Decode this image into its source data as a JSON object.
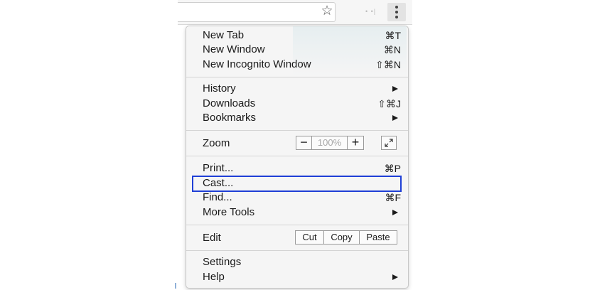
{
  "toolbar": {
    "bookmark_icon": "star-icon",
    "menu_icon": "kebab-icon"
  },
  "menu": {
    "new_tab": {
      "label": "New Tab",
      "shortcut": "⌘T"
    },
    "new_window": {
      "label": "New Window",
      "shortcut": "⌘N"
    },
    "new_incognito": {
      "label": "New Incognito Window",
      "shortcut": "⇧⌘N"
    },
    "history": {
      "label": "History"
    },
    "downloads": {
      "label": "Downloads",
      "shortcut": "⇧⌘J"
    },
    "bookmarks": {
      "label": "Bookmarks"
    },
    "zoom": {
      "label": "Zoom",
      "minus": "−",
      "value": "100%",
      "plus": "+"
    },
    "print": {
      "label": "Print...",
      "shortcut": "⌘P"
    },
    "cast": {
      "label": "Cast..."
    },
    "find": {
      "label": "Find...",
      "shortcut": "⌘F"
    },
    "more_tools": {
      "label": "More Tools"
    },
    "edit": {
      "label": "Edit",
      "cut": "Cut",
      "copy": "Copy",
      "paste": "Paste"
    },
    "settings": {
      "label": "Settings"
    },
    "help": {
      "label": "Help"
    }
  },
  "colors": {
    "highlight": "#1f3fd6",
    "menu_bg": "#f5f5f5"
  }
}
